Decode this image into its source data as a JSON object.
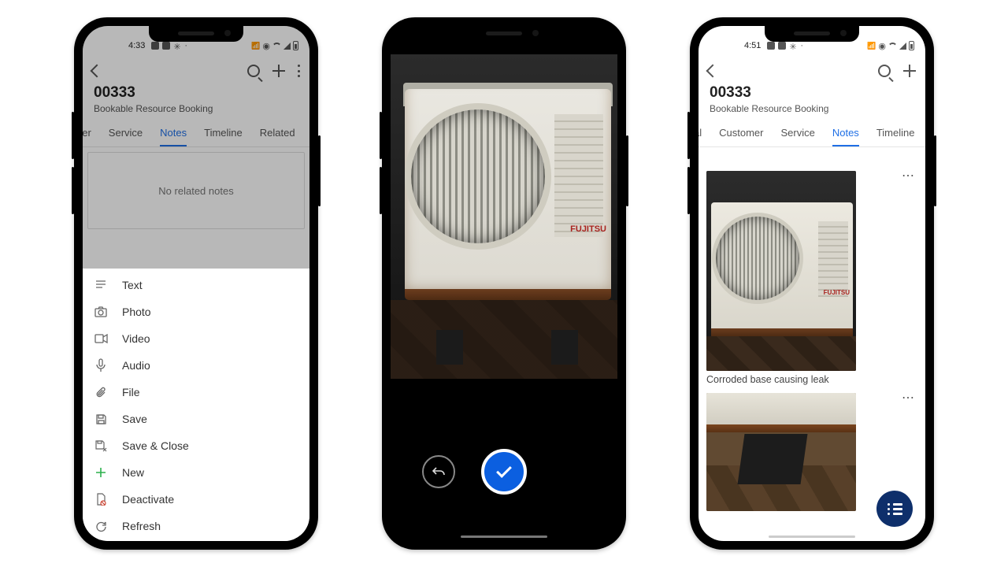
{
  "phone1": {
    "status_time": "4:33",
    "title": "00333",
    "subtitle": "Bookable Resource Booking",
    "tabs": [
      "ner",
      "Service",
      "Notes",
      "Timeline",
      "Related"
    ],
    "active_tab_index": 2,
    "empty_state": "No related notes",
    "menu": [
      {
        "icon": "text",
        "label": "Text"
      },
      {
        "icon": "photo",
        "label": "Photo"
      },
      {
        "icon": "video",
        "label": "Video"
      },
      {
        "icon": "audio",
        "label": "Audio"
      },
      {
        "icon": "file",
        "label": "File"
      },
      {
        "icon": "save",
        "label": "Save"
      },
      {
        "icon": "save-close",
        "label": "Save & Close"
      },
      {
        "icon": "new",
        "label": "New"
      },
      {
        "icon": "deactivate",
        "label": "Deactivate"
      },
      {
        "icon": "refresh",
        "label": "Refresh"
      }
    ]
  },
  "phone2": {
    "subject": "air-conditioner-outdoor-unit",
    "brand": "FUJITSU"
  },
  "phone3": {
    "status_time": "4:51",
    "title": "00333",
    "subtitle": "Bookable Resource Booking",
    "tabs": [
      "al",
      "Customer",
      "Service",
      "Notes",
      "Timeline"
    ],
    "active_tab_index": 3,
    "notes": [
      {
        "caption": "Corroded base causing leak",
        "brand": "FUJITSU"
      },
      {
        "caption": ""
      }
    ]
  }
}
